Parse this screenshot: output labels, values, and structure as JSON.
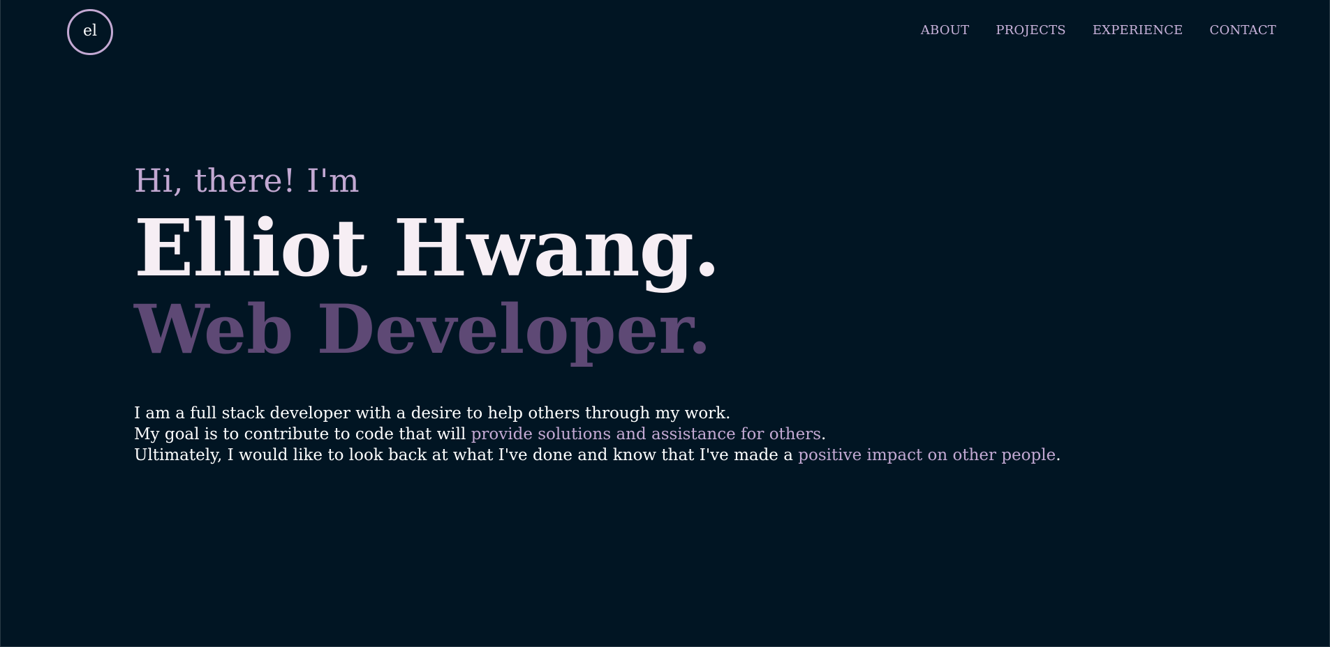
{
  "header": {
    "logo_text": "el",
    "nav": [
      {
        "label": "ABOUT"
      },
      {
        "label": "PROJECTS"
      },
      {
        "label": "EXPERIENCE"
      },
      {
        "label": "CONTACT"
      }
    ]
  },
  "hero": {
    "greeting": "Hi, there! I'm",
    "name": "Elliot Hwang.",
    "role": "Web Developer.",
    "intro": {
      "line1": "I am a full stack developer with a desire to help others through my work.",
      "line2_prefix": "My goal is to contribute to code that will ",
      "line2_highlight": "provide solutions and assistance for others",
      "line2_suffix": ".",
      "line3_prefix": "Ultimately, I would like to look back at what I've done and know that I've made a ",
      "line3_highlight": "positive impact on other people",
      "line3_suffix": "."
    }
  },
  "colors": {
    "background": "#011523",
    "accent": "#c3a9d3",
    "role": "#5e4975",
    "text": "#f6eef4"
  }
}
